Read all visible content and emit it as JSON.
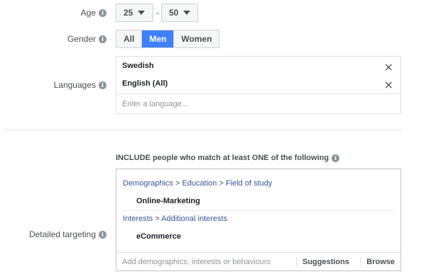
{
  "age": {
    "label": "Age",
    "min_value": "25",
    "separator": "-",
    "max_value": "50"
  },
  "gender": {
    "label": "Gender",
    "options": [
      "All",
      "Men",
      "Women"
    ],
    "selected": "Men"
  },
  "languages": {
    "label": "Languages",
    "items": [
      "Swedish",
      "English (All)"
    ],
    "placeholder": "Enter a language..."
  },
  "detailed_targeting": {
    "label": "Detailed targeting",
    "include_text": "INCLUDE people who match at least ONE of the following",
    "groups": [
      {
        "path": [
          "Demographics",
          "Education",
          "Field of study"
        ],
        "value": "Online-Marketing"
      },
      {
        "path": [
          "Interests",
          "Additional interests"
        ],
        "value": "eCommerce"
      }
    ],
    "placeholder": "Add demographics, interests or behaviours",
    "suggestions_label": "Suggestions",
    "browse_label": "Browse"
  },
  "icons": {
    "info": "info-icon",
    "remove": "close-icon",
    "dropdown": "caret-down-icon"
  },
  "colors": {
    "accent": "#4080ff",
    "link": "#365899"
  }
}
